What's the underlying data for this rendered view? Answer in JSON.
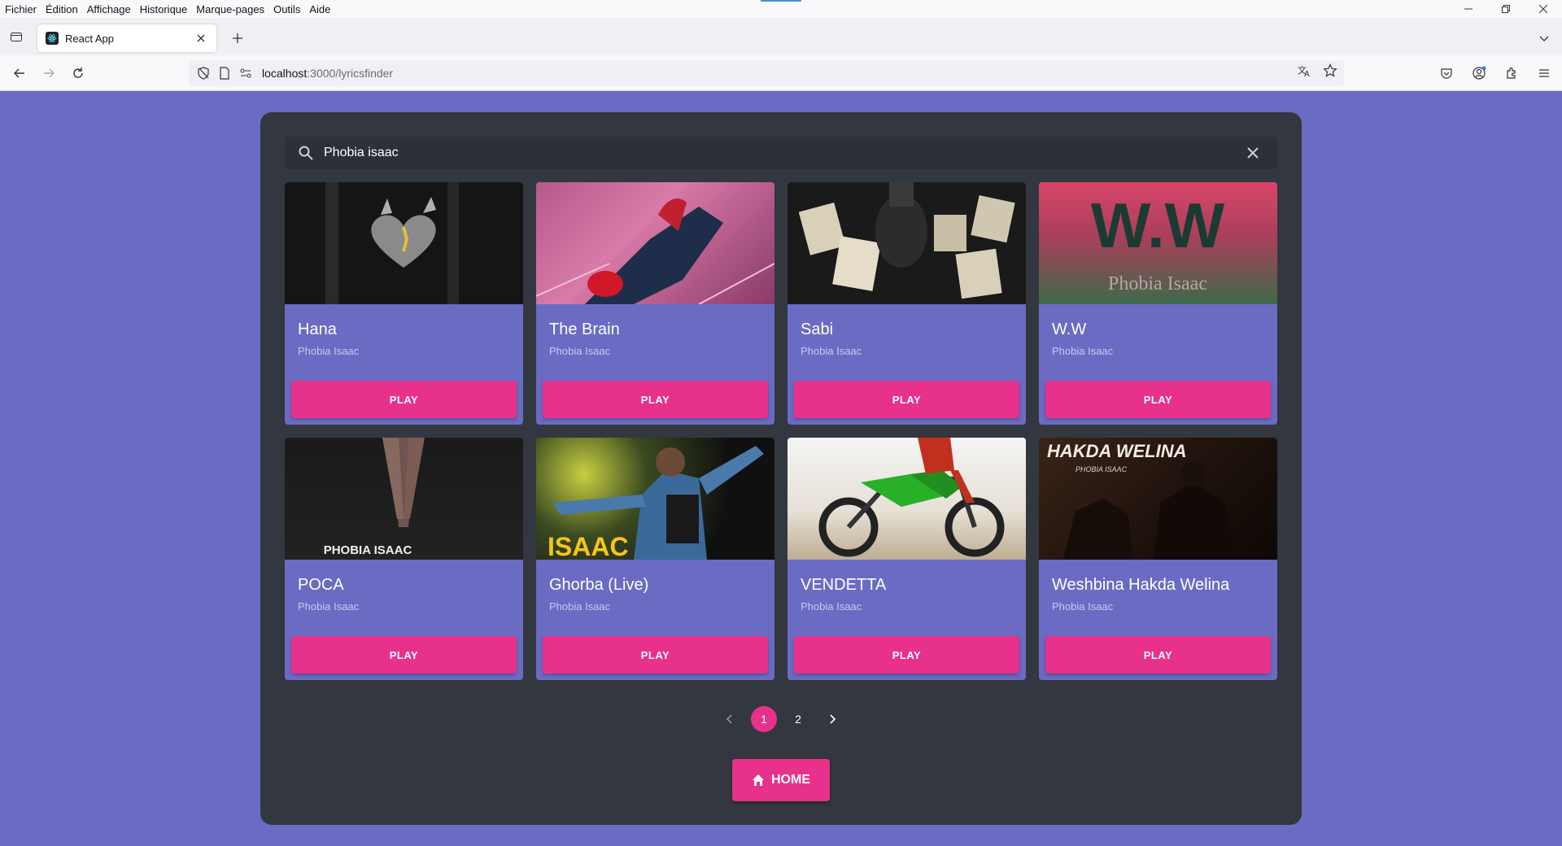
{
  "menubar": {
    "items": [
      "Fichier",
      "Édition",
      "Affichage",
      "Historique",
      "Marque-pages",
      "Outils",
      "Aide"
    ]
  },
  "browser": {
    "tab_title": "React App",
    "url_host": "localhost",
    "url_path": ":3000/lyricsfinder"
  },
  "search": {
    "value": "Phobia isaac"
  },
  "songs": [
    {
      "title": "Hana",
      "artist": "Phobia Isaac",
      "play_label": "PLAY"
    },
    {
      "title": "The Brain",
      "artist": "Phobia Isaac",
      "play_label": "PLAY"
    },
    {
      "title": "Sabi",
      "artist": "Phobia Isaac",
      "play_label": "PLAY"
    },
    {
      "title": "W.W",
      "artist": "Phobia Isaac",
      "play_label": "PLAY",
      "art_text": "W.W",
      "art_subtext": "Phobia Isaac"
    },
    {
      "title": "POCA",
      "artist": "Phobia Isaac",
      "play_label": "PLAY",
      "art_text": "PHOBIA ISAAC"
    },
    {
      "title": "Ghorba (Live)",
      "artist": "Phobia Isaac",
      "play_label": "PLAY",
      "art_text": "ISAAC"
    },
    {
      "title": "VENDETTA",
      "artist": "Phobia Isaac",
      "play_label": "PLAY"
    },
    {
      "title": "Weshbina Hakda Welina",
      "artist": "Phobia Isaac",
      "play_label": "PLAY",
      "art_text": "HAKDA WELINA",
      "art_subtext": "PHOBIA ISAAC"
    }
  ],
  "pagination": {
    "pages": [
      "1",
      "2"
    ],
    "current": "1"
  },
  "home_label": "HOME",
  "colors": {
    "page_bg": "#6b6bc4",
    "panel_bg": "#33373f",
    "accent": "#e8318a",
    "card_bg": "#6b6bc4"
  }
}
